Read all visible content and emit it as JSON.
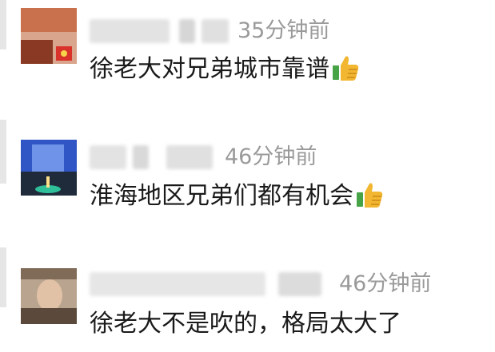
{
  "comments": [
    {
      "time": "35分钟前",
      "text": "徐老大对兄弟城市靠谱",
      "emoji": "thumbs-up-icon"
    },
    {
      "time": "46分钟前",
      "text": "淮海地区兄弟们都有机会",
      "emoji": "thumbs-up-icon"
    },
    {
      "time": "46分钟前",
      "text": "徐老大不是吹的，格局太大了"
    }
  ],
  "colors": {
    "time": "#9a9a9a",
    "text": "#1a1a1a",
    "quote_bar": "#e6e6e6",
    "thumb": "#f2b630"
  }
}
